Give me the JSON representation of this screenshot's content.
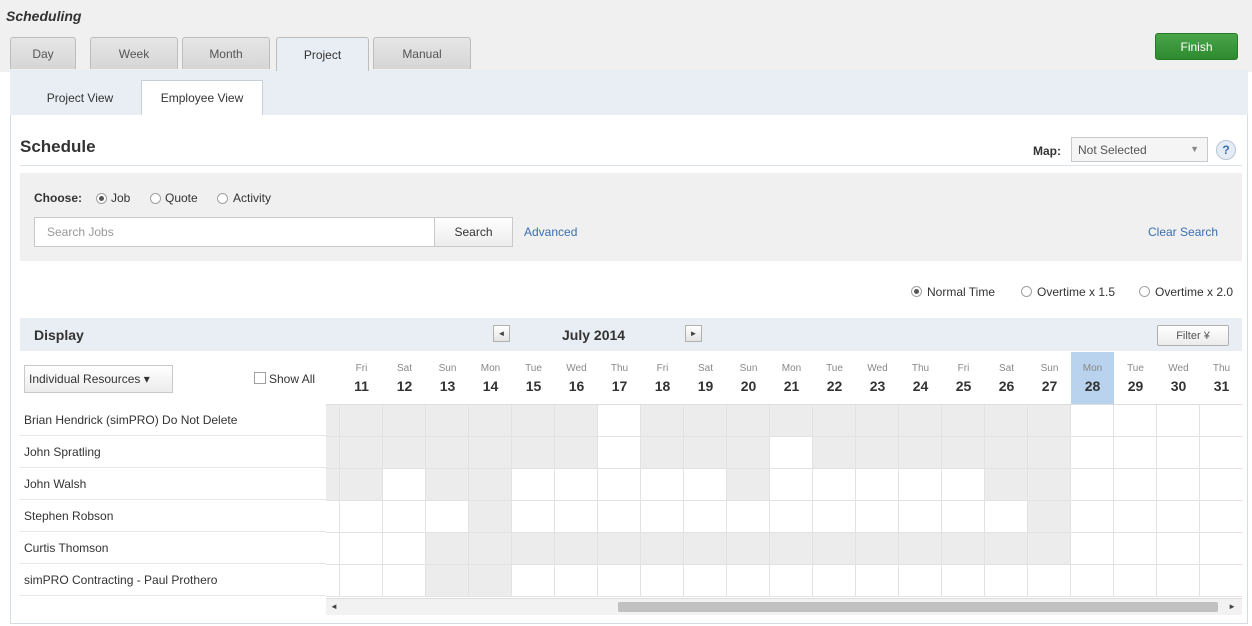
{
  "app": {
    "title": "Scheduling"
  },
  "top_tabs": [
    {
      "label": "Day",
      "active": false
    },
    {
      "label": "Week",
      "active": false
    },
    {
      "label": "Month",
      "active": false
    },
    {
      "label": "Project",
      "active": true
    },
    {
      "label": "Manual",
      "active": false
    }
  ],
  "finish_label": "Finish",
  "sub_tabs": [
    {
      "label": "Project View",
      "active": false
    },
    {
      "label": "Employee View",
      "active": true
    }
  ],
  "schedule": {
    "title": "Schedule",
    "map_label": "Map:",
    "map_value": "Not Selected",
    "help_glyph": "?"
  },
  "search": {
    "choose_label": "Choose:",
    "options": [
      {
        "label": "Job",
        "checked": true
      },
      {
        "label": "Quote",
        "checked": false
      },
      {
        "label": "Activity",
        "checked": false
      }
    ],
    "placeholder": "Search Jobs",
    "button_label": "Search",
    "advanced_label": "Advanced",
    "clear_label": "Clear Search"
  },
  "time_options": [
    {
      "label": "Normal Time",
      "checked": true
    },
    {
      "label": "Overtime x 1.5",
      "checked": false
    },
    {
      "label": "Overtime x 2.0",
      "checked": false
    }
  ],
  "display": {
    "label": "Display",
    "month": "July 2014",
    "prev_glyph": "◄",
    "next_glyph": "►",
    "filter_label": "Filter ¥",
    "resources_label": "Individual Resources ▾",
    "show_all_label": "Show All"
  },
  "days": [
    {
      "dow": "Fri",
      "num": "11"
    },
    {
      "dow": "Sat",
      "num": "12"
    },
    {
      "dow": "Sun",
      "num": "13"
    },
    {
      "dow": "Mon",
      "num": "14"
    },
    {
      "dow": "Tue",
      "num": "15"
    },
    {
      "dow": "Wed",
      "num": "16"
    },
    {
      "dow": "Thu",
      "num": "17"
    },
    {
      "dow": "Fri",
      "num": "18"
    },
    {
      "dow": "Sat",
      "num": "19"
    },
    {
      "dow": "Sun",
      "num": "20"
    },
    {
      "dow": "Mon",
      "num": "21"
    },
    {
      "dow": "Tue",
      "num": "22"
    },
    {
      "dow": "Wed",
      "num": "23"
    },
    {
      "dow": "Thu",
      "num": "24"
    },
    {
      "dow": "Fri",
      "num": "25"
    },
    {
      "dow": "Sat",
      "num": "26"
    },
    {
      "dow": "Sun",
      "num": "27"
    },
    {
      "dow": "Mon",
      "num": "28"
    },
    {
      "dow": "Tue",
      "num": "29"
    },
    {
      "dow": "Wed",
      "num": "30"
    },
    {
      "dow": "Thu",
      "num": "31"
    }
  ],
  "today_num": "28",
  "employees": [
    {
      "name": "Brian Hendrick (simPRO) Do Not Delete",
      "busy": [
        1,
        1,
        1,
        1,
        1,
        1,
        0,
        1,
        1,
        1,
        1,
        1,
        1,
        1,
        1,
        1,
        1,
        0,
        0,
        0,
        0
      ]
    },
    {
      "name": "John Spratling",
      "busy": [
        1,
        1,
        1,
        1,
        1,
        1,
        0,
        1,
        1,
        1,
        0,
        1,
        1,
        1,
        1,
        1,
        1,
        0,
        0,
        0,
        0
      ]
    },
    {
      "name": "John Walsh",
      "busy": [
        1,
        0,
        1,
        1,
        0,
        0,
        0,
        0,
        0,
        1,
        0,
        0,
        0,
        0,
        0,
        1,
        1,
        0,
        0,
        0,
        0
      ]
    },
    {
      "name": "Stephen Robson",
      "busy": [
        0,
        0,
        0,
        1,
        0,
        0,
        0,
        0,
        0,
        0,
        0,
        0,
        0,
        0,
        0,
        0,
        1,
        0,
        0,
        0,
        0
      ]
    },
    {
      "name": "Curtis Thomson",
      "busy": [
        0,
        0,
        1,
        1,
        1,
        1,
        1,
        1,
        1,
        1,
        1,
        1,
        1,
        1,
        1,
        1,
        1,
        0,
        0,
        0,
        0
      ]
    },
    {
      "name": "simPRO Contracting - Paul Prothero",
      "busy": [
        0,
        0,
        1,
        1,
        0,
        0,
        0,
        0,
        0,
        0,
        0,
        0,
        0,
        0,
        0,
        0,
        0,
        0,
        0,
        0,
        0
      ]
    }
  ],
  "scroll": {
    "left_glyph": "◄",
    "right_glyph": "►"
  }
}
